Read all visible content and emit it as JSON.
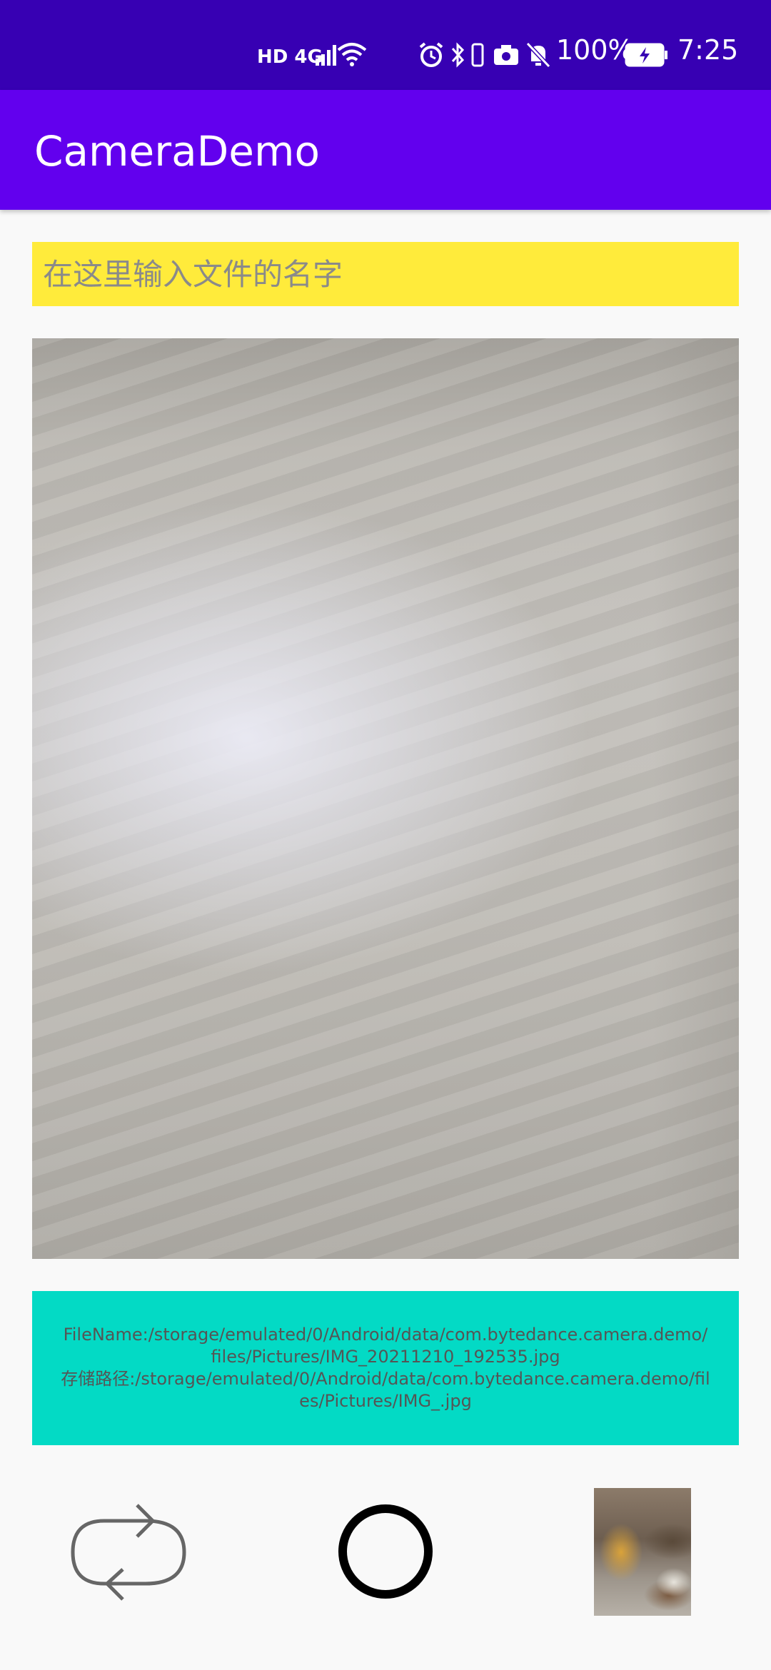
{
  "status_bar": {
    "network": "HD 4G",
    "battery_percent": "100%",
    "time": "7:25",
    "icons": [
      "hd-icon",
      "signal-icon",
      "wifi-icon",
      "alarm-icon",
      "bluetooth-icon",
      "vibrate-icon",
      "camera-icon",
      "mute-icon",
      "battery-charging-icon"
    ]
  },
  "app_bar": {
    "title": "CameraDemo"
  },
  "filename_input": {
    "placeholder": "在这里输入文件的名字",
    "value": ""
  },
  "path_info": {
    "filename_line": "FileName:/storage/emulated/0/Android/data/com.bytedance.camera.demo/files/Pictures/IMG_20211210_192535.jpg",
    "storage_line": "存储路径:/storage/emulated/0/Android/data/com.bytedance.camera.demo/files/Pictures/IMG_.jpg"
  },
  "controls": {
    "switch_icon": "switch-camera-icon",
    "shutter_icon": "shutter-icon",
    "thumbnail": "last-photo-thumbnail"
  },
  "colors": {
    "status_bar": "#3700b3",
    "app_bar": "#6200ee",
    "input_bg": "#ffeb3b",
    "path_panel_bg": "#03dac5"
  }
}
